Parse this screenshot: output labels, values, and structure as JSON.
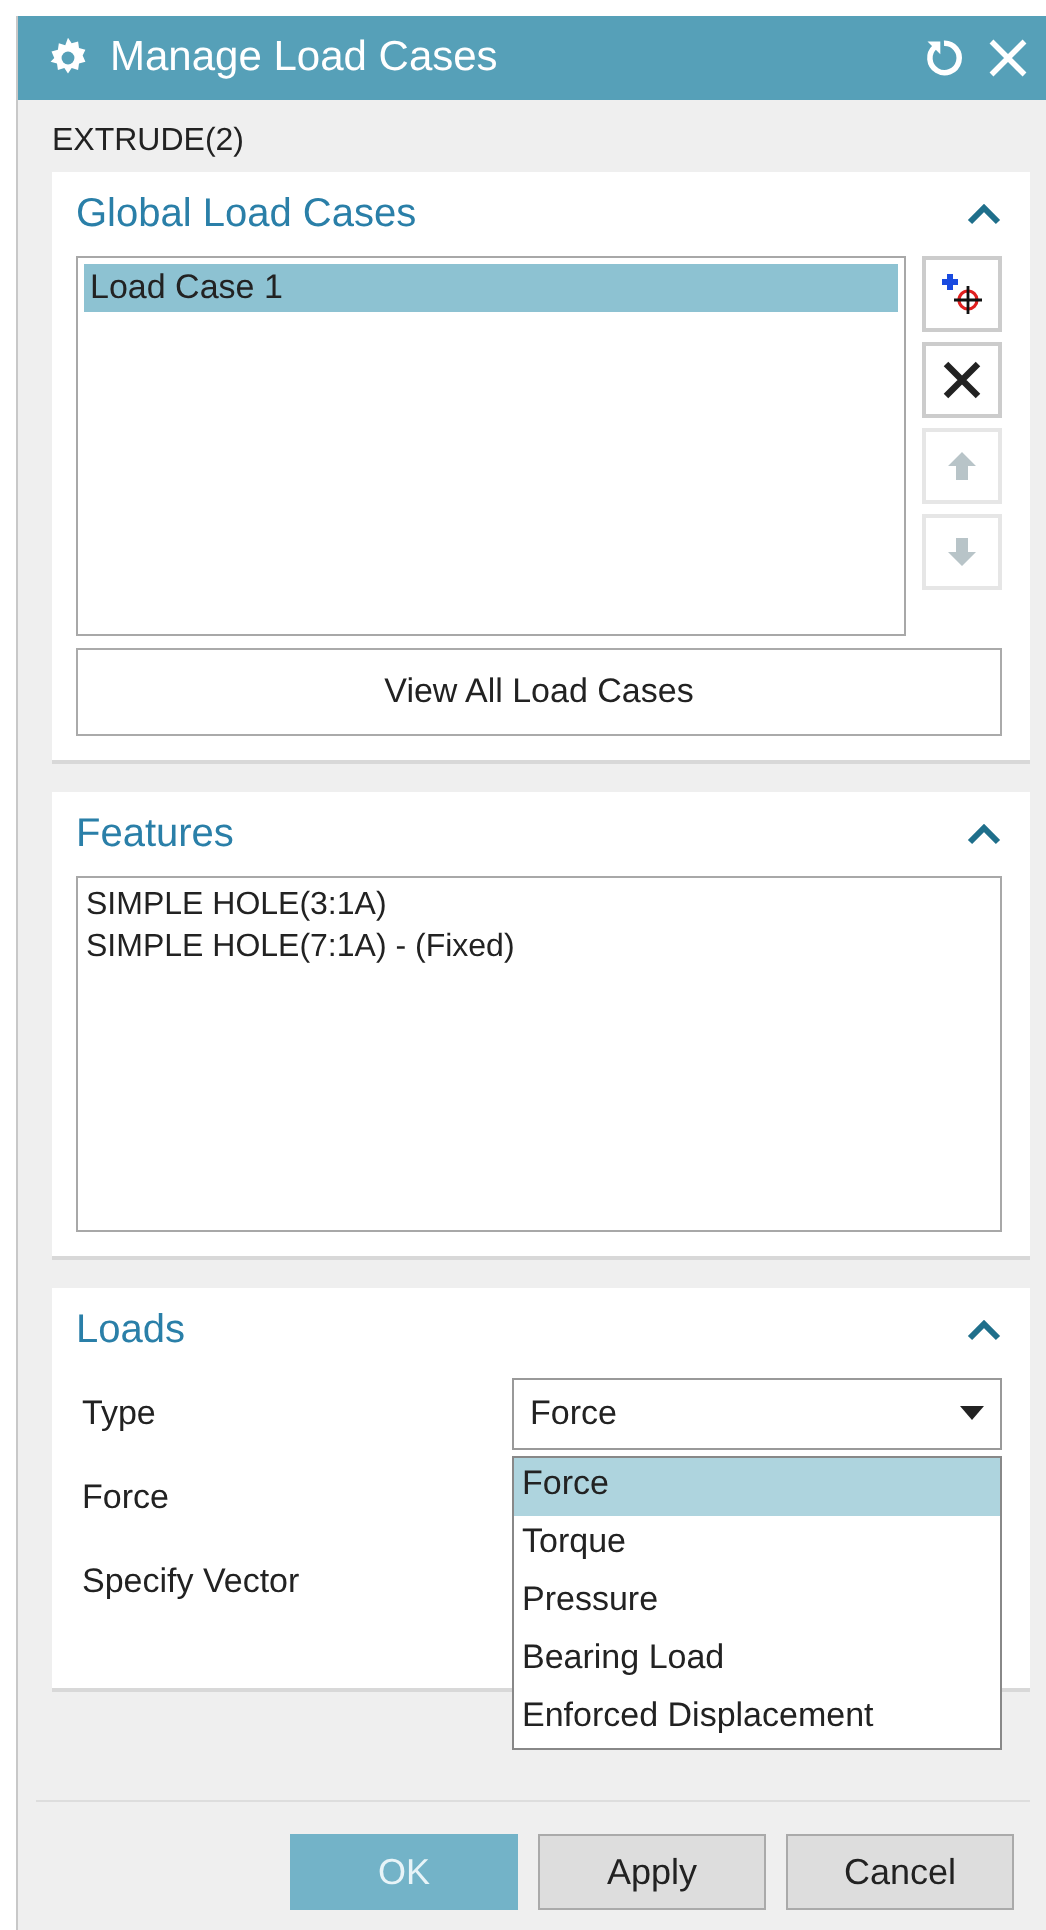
{
  "window": {
    "title": "Manage Load Cases"
  },
  "feature_label": "EXTRUDE(2)",
  "global_load_cases": {
    "title": "Global Load Cases",
    "expanded": true,
    "items": [
      {
        "label": "Load Case 1",
        "selected": true
      }
    ],
    "tools": [
      {
        "kind": "add",
        "disabled": false
      },
      {
        "kind": "delete",
        "disabled": false
      },
      {
        "kind": "up",
        "disabled": true
      },
      {
        "kind": "down",
        "disabled": true
      }
    ],
    "view_all_button": "View All Load Cases"
  },
  "features": {
    "title": "Features",
    "expanded": true,
    "items": [
      {
        "label": "SIMPLE HOLE(3:1A)"
      },
      {
        "label": "SIMPLE HOLE(7:1A) - (Fixed)"
      }
    ]
  },
  "loads": {
    "title": "Loads",
    "expanded": true,
    "type_label": "Type",
    "type_value": "Force",
    "dropdown_open": true,
    "options": [
      {
        "label": "Force",
        "selected": true
      },
      {
        "label": "Torque",
        "selected": false
      },
      {
        "label": "Pressure",
        "selected": false
      },
      {
        "label": "Bearing Load",
        "selected": false
      },
      {
        "label": "Enforced Displacement",
        "selected": false
      }
    ],
    "force_label": "Force",
    "vector_label": "Specify Vector"
  },
  "buttons": [
    {
      "label": "OK",
      "kind": "primary"
    },
    {
      "label": "Apply",
      "kind": "normal"
    },
    {
      "label": "Cancel",
      "kind": "normal"
    }
  ]
}
